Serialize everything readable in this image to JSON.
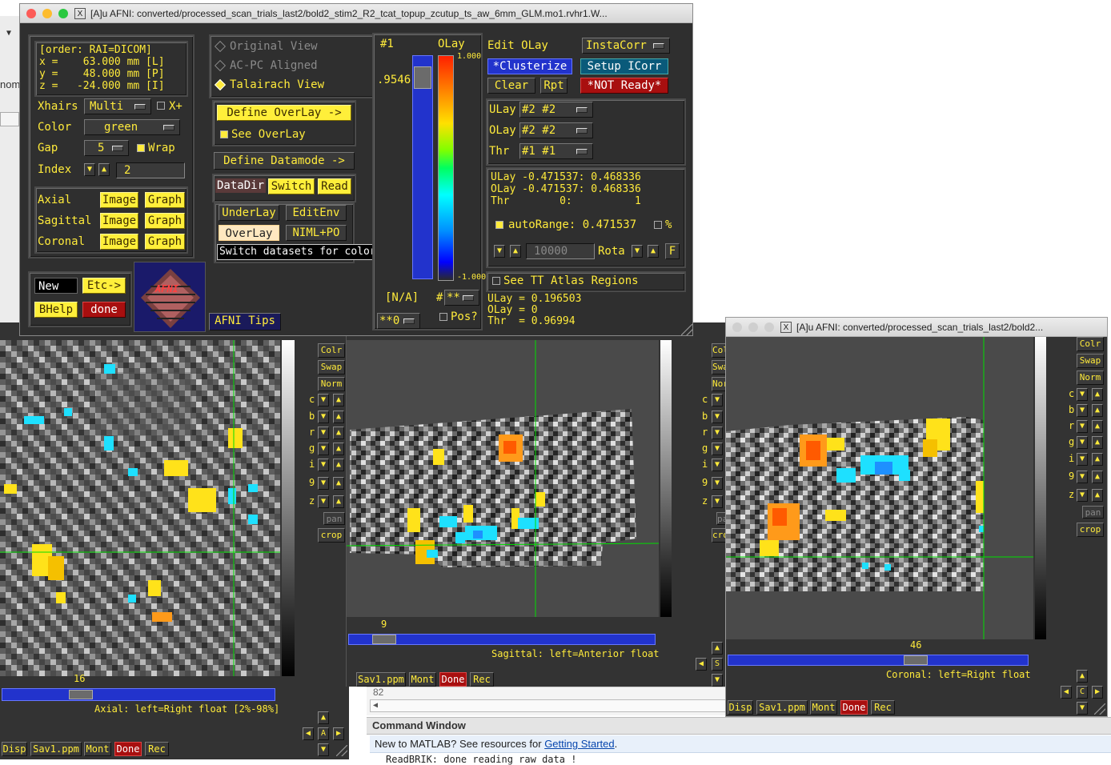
{
  "main_window": {
    "title": "[A]u AFNI: converted/processed_scan_trials_last2/bold2_stim2_R2_tcat_topup_zcutup_ts_aw_6mm_GLM.mo1.rvhr1.W...",
    "coords": {
      "order": "[order: RAI=DICOM]",
      "x": "x =    63.000 mm [L]",
      "y": "y =    48.000 mm [P]",
      "z": "z =   -24.000 mm [I]"
    },
    "xhairs_label": "Xhairs",
    "xhairs_value": "Multi",
    "xplus_label": "X+",
    "color_label": "Color",
    "color_value": "green",
    "gap_label": "Gap",
    "gap_value": "5",
    "wrap_label": "Wrap",
    "index_label": "Index",
    "index_value": "2",
    "axial_label": "Axial",
    "sagittal_label": "Sagittal",
    "coronal_label": "Coronal",
    "image_label": "Image",
    "graph_label": "Graph",
    "new_label": "New",
    "etc_label": "Etc->",
    "bhelp_label": "BHelp",
    "done_label": "done",
    "logo_text": "AFNI",
    "view_original": "Original View",
    "view_acpc": "AC-PC Aligned",
    "view_talairach": "Talairach View",
    "define_overlay": "Define OverLay ->",
    "see_overlay": "See OverLay",
    "define_datamode": "Define Datamode ->",
    "datadir": "DataDir",
    "switch": "Switch",
    "read": "Read",
    "underlay": "UnderLay",
    "editenv": "EditEnv",
    "overlay": "OverLay",
    "niml_po": "NIML+PO",
    "tooltip": "Switch datasets for color overlay",
    "afni_tips": "AFNI Tips",
    "bar_index": "#1",
    "bar_value": ".9546",
    "olay_label": "OLay",
    "scale_top": "1.000",
    "scale_bottom": "-1.000",
    "na_label": "[N/A]",
    "hash_label": "#",
    "stars_label": "**",
    "zero_label": "**0",
    "pos_label": "Pos?",
    "edit_olay": "Edit OLay",
    "instacorr": "InstaCorr",
    "clusterize": "*Clusterize",
    "setup_icorr": "Setup ICorr",
    "clear": "Clear",
    "rpt": "Rpt",
    "not_ready": "*NOT Ready*",
    "ulay_label": "ULay",
    "ulay_value": "#2 #2",
    "olay_sel_label": "OLay",
    "olay_sel_value": "#2 #2",
    "thr_label": "Thr",
    "thr_value": "#1 #1",
    "range_ulay": "ULay -0.471537: 0.468336",
    "range_olay": "OLay -0.471537: 0.468336",
    "range_thr": "Thr        0:          1",
    "autorange": "autoRange: 0.471537",
    "percent": "%",
    "ten_thousand": "10000",
    "rota": "Rota",
    "f_label": "F",
    "see_tt": "See TT Atlas Regions",
    "val_ulay": "ULay = 0.196503",
    "val_olay": "OLay = 0",
    "val_thr": "Thr  = 0.96994"
  },
  "side_buttons": {
    "colr": "Colr",
    "swap": "Swap",
    "norm": "Norm",
    "c": "c",
    "b": "b",
    "r": "r",
    "g": "g",
    "i": "i",
    "nine": "9",
    "z": "z",
    "pan": "pan",
    "crop": "crop"
  },
  "axial": {
    "slice": "16",
    "caption": "Axial: left=Right float [2%-98%]",
    "slider_fraction": 0.28
  },
  "sagittal": {
    "slice": "9",
    "caption": "Sagittal: left=Anterior float",
    "slider_fraction": 0.12
  },
  "coronal": {
    "title": "[A]u AFNI: converted/processed_scan_trials_last2/bold2...",
    "slice": "46",
    "caption": "Coronal: left=Right float",
    "slider_fraction": 0.62
  },
  "toolbar": {
    "disp": "Disp",
    "sav": "Sav1.ppm",
    "mont": "Mont",
    "done": "Done",
    "rec": "Rec"
  },
  "corner_buttons": {
    "a": "A",
    "s": "S",
    "c": "C"
  },
  "matlab": {
    "line_number": "82",
    "command_window": "Command Window",
    "new_to": "New to MATLAB? See resources for ",
    "getting_started": "Getting Started",
    "period": ".",
    "partial_text": "ReadBRIK: done reading raw data !",
    "left_partial": "nom"
  },
  "colors": {
    "panel": "#2f2f2f",
    "label_yellow": "#ffeb3b",
    "button_yellow": "#ffef3a",
    "slider_blue": "#2233cc",
    "done_red": "#a80f0f",
    "crosshair_green": "#00dd00"
  }
}
